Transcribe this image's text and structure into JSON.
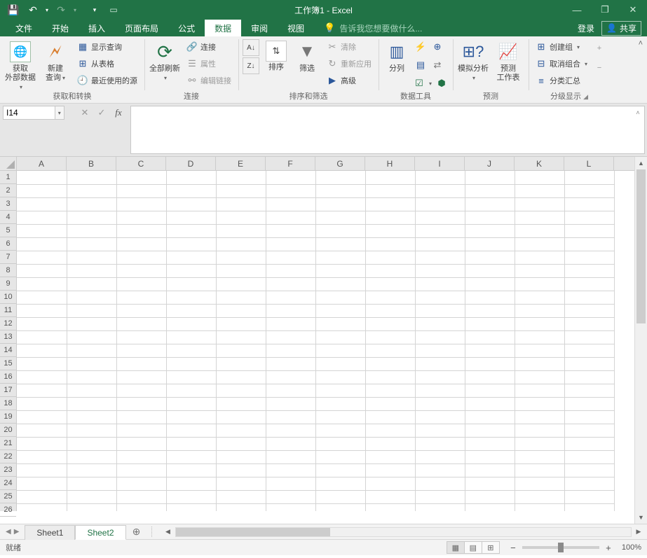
{
  "title": "工作簿1 - Excel",
  "qat": {
    "save": "💾",
    "undo": "↶",
    "redo": "↷",
    "custom": "▾"
  },
  "window": {
    "opts": "▢",
    "min": "—",
    "max": "❐",
    "close": "✕"
  },
  "tabs": {
    "file": "文件",
    "home": "开始",
    "insert": "插入",
    "layout": "页面布局",
    "formulas": "公式",
    "data": "数据",
    "review": "审阅",
    "view": "视图"
  },
  "tellme_placeholder": "告诉我您想要做什么...",
  "login": "登录",
  "share": "共享",
  "ribbon": {
    "g1": {
      "ext": "获取\n外部数据",
      "newq": "新建\n查询",
      "show": "显示查询",
      "table": "从表格",
      "recent": "最近使用的源",
      "label": "获取和转换"
    },
    "g2": {
      "refresh": "全部刷新",
      "conn": "连接",
      "prop": "属性",
      "editlink": "编辑链接",
      "label": "连接"
    },
    "g3": {
      "az": "A→Z",
      "za": "Z→A",
      "sort": "排序",
      "filter": "筛选",
      "clear": "清除",
      "reapply": "重新应用",
      "adv": "高级",
      "label": "排序和筛选"
    },
    "g4": {
      "texttocols": "分列",
      "label": "数据工具"
    },
    "g5": {
      "whatif": "模拟分析",
      "forecast": "预测\n工作表",
      "label": "预测"
    },
    "g6": {
      "group": "创建组",
      "ungroup": "取消组合",
      "subtotal": "分类汇总",
      "label": "分级显示"
    }
  },
  "namebox": "I14",
  "fx": {
    "cancel": "✕",
    "enter": "✓",
    "fx": "fx"
  },
  "columns": [
    "A",
    "B",
    "C",
    "D",
    "E",
    "F",
    "G",
    "H",
    "I",
    "J",
    "K",
    "L"
  ],
  "rows": [
    "1",
    "2",
    "3",
    "4",
    "5",
    "6",
    "7",
    "8",
    "9",
    "10",
    "11",
    "12",
    "13",
    "14",
    "15",
    "16",
    "17",
    "18",
    "19",
    "20",
    "21",
    "22",
    "23",
    "24",
    "25",
    "26"
  ],
  "sheets": {
    "s1": "Sheet1",
    "s2": "Sheet2"
  },
  "status": "就绪",
  "zoom": "100%"
}
